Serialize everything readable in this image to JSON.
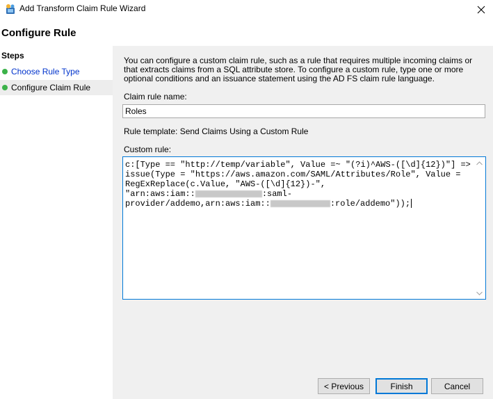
{
  "window": {
    "title": "Add Transform Claim Rule Wizard",
    "close_glyph": "✕"
  },
  "page": {
    "title": "Configure Rule"
  },
  "steps": {
    "header": "Steps",
    "items": [
      {
        "label": "Choose Rule Type",
        "state": "completed-link"
      },
      {
        "label": "Configure Claim Rule",
        "state": "current"
      }
    ]
  },
  "content": {
    "description": "You can configure a custom claim rule, such as a rule that requires multiple incoming claims or that extracts claims from a SQL attribute store. To configure a custom rule, type one or more optional conditions and an issuance statement using the AD FS claim rule language.",
    "claim_rule_name_label": "Claim rule name:",
    "claim_rule_name_value": "Roles",
    "rule_template": "Rule template: Send Claims Using a Custom Rule",
    "custom_rule_label": "Custom rule:",
    "custom_rule": {
      "line1": "c:[Type == \"http://temp/variable\", Value =~ \"(?i)^AWS-([\\d]{12})\"] =>",
      "line2": "issue(Type = \"https://aws.amazon.com/SAML/Attributes/Role\", Value =",
      "line3": "RegExReplace(c.Value, \"AWS-([\\d]{12})-\",",
      "line4_prefix": "\"arn:aws:iam::",
      "line4_suffix": ":saml-",
      "line5_prefix": "provider/addemo,arn:aws:iam::",
      "line5_suffix": ":role/addemo\"));"
    }
  },
  "buttons": {
    "previous": "< Previous",
    "finish": "Finish",
    "cancel": "Cancel"
  },
  "colors": {
    "accent": "#0078d7",
    "step_done": "#3cb24a",
    "link": "#0033cc"
  }
}
